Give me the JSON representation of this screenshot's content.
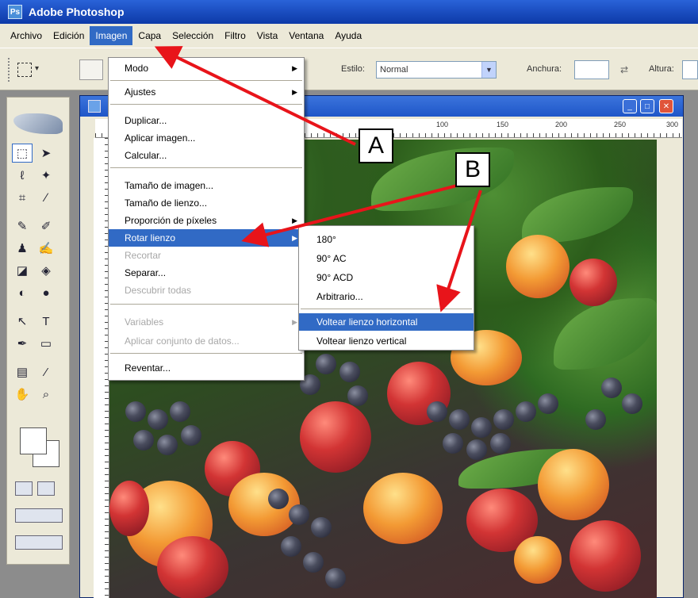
{
  "window": {
    "title": "Adobe Photoshop"
  },
  "menubar": {
    "items": [
      {
        "label": "Archivo"
      },
      {
        "label": "Edición"
      },
      {
        "label": "Imagen"
      },
      {
        "label": "Capa"
      },
      {
        "label": "Selección"
      },
      {
        "label": "Filtro"
      },
      {
        "label": "Vista"
      },
      {
        "label": "Ventana"
      },
      {
        "label": "Ayuda"
      }
    ]
  },
  "options_bar": {
    "estilo_label": "Estilo:",
    "estilo_value": "Normal",
    "anchura_label": "Anchura:",
    "altura_label": "Altura:"
  },
  "ruler": {
    "ticks": [
      "100",
      "150",
      "200",
      "250",
      "300"
    ]
  },
  "image_menu": {
    "items": [
      {
        "label": "Modo",
        "submenu": true,
        "enabled": true
      },
      {
        "label": "Ajustes",
        "submenu": true,
        "enabled": true
      },
      {
        "label": "Duplicar...",
        "submenu": false,
        "enabled": true
      },
      {
        "label": "Aplicar imagen...",
        "submenu": false,
        "enabled": true
      },
      {
        "label": "Calcular...",
        "submenu": false,
        "enabled": true
      },
      {
        "label": "Tamaño de imagen...",
        "submenu": false,
        "enabled": true
      },
      {
        "label": "Tamaño de lienzo...",
        "submenu": false,
        "enabled": true
      },
      {
        "label": "Proporción de píxeles",
        "submenu": true,
        "enabled": true
      },
      {
        "label": "Rotar lienzo",
        "submenu": true,
        "enabled": true,
        "highlighted": true
      },
      {
        "label": "Recortar",
        "submenu": false,
        "enabled": false
      },
      {
        "label": "Separar...",
        "submenu": false,
        "enabled": true
      },
      {
        "label": "Descubrir todas",
        "submenu": false,
        "enabled": false
      },
      {
        "label": "Variables",
        "submenu": true,
        "enabled": false
      },
      {
        "label": "Aplicar conjunto de datos...",
        "submenu": false,
        "enabled": false
      },
      {
        "label": "Reventar...",
        "submenu": false,
        "enabled": true
      }
    ]
  },
  "rotate_submenu": {
    "items": [
      {
        "label": "180°"
      },
      {
        "label": "90° AC"
      },
      {
        "label": "90° ACD"
      },
      {
        "label": "Arbitrario..."
      },
      {
        "label": "Voltear lienzo horizontal",
        "highlighted": true
      },
      {
        "label": "Voltear lienzo vertical"
      }
    ]
  },
  "callouts": {
    "a": "A",
    "b": "B"
  },
  "colors": {
    "highlight": "#316ac5",
    "arrow": "#e8141a",
    "titlebar": "#1c4fc2"
  }
}
